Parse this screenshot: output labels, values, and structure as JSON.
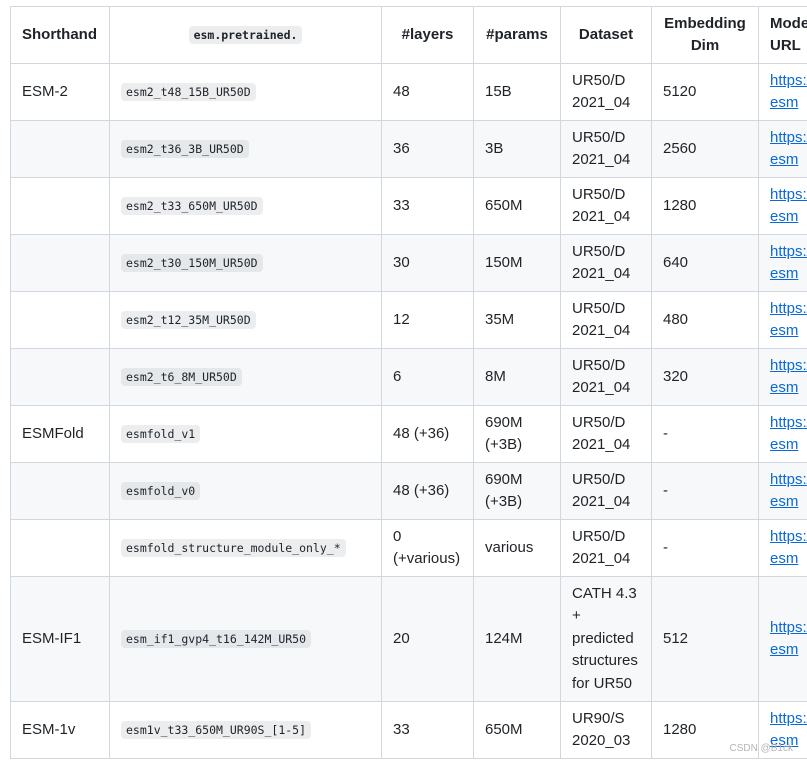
{
  "table": {
    "headers": [
      "Shorthand",
      "esm.pretrained.",
      "#layers",
      "#params",
      "Dataset",
      "Embedding\nDim",
      "Model URL"
    ],
    "rows": [
      {
        "shorthand": "ESM-2",
        "name": "esm2_t48_15B_UR50D",
        "layers": "48",
        "params": "15B",
        "dataset": "UR50/D\n2021_04",
        "dim": "5120",
        "url": "https://\nesm"
      },
      {
        "shorthand": "",
        "name": "esm2_t36_3B_UR50D",
        "layers": "36",
        "params": "3B",
        "dataset": "UR50/D\n2021_04",
        "dim": "2560",
        "url": "https://\nesm"
      },
      {
        "shorthand": "",
        "name": "esm2_t33_650M_UR50D",
        "layers": "33",
        "params": "650M",
        "dataset": "UR50/D\n2021_04",
        "dim": "1280",
        "url": "https://\nesm"
      },
      {
        "shorthand": "",
        "name": "esm2_t30_150M_UR50D",
        "layers": "30",
        "params": "150M",
        "dataset": "UR50/D\n2021_04",
        "dim": "640",
        "url": "https://\nesm"
      },
      {
        "shorthand": "",
        "name": "esm2_t12_35M_UR50D",
        "layers": "12",
        "params": "35M",
        "dataset": "UR50/D\n2021_04",
        "dim": "480",
        "url": "https://\nesm"
      },
      {
        "shorthand": "",
        "name": "esm2_t6_8M_UR50D",
        "layers": "6",
        "params": "8M",
        "dataset": "UR50/D\n2021_04",
        "dim": "320",
        "url": "https://\nesm"
      },
      {
        "shorthand": "ESMFold",
        "name": "esmfold_v1",
        "layers": "48 (+36)",
        "params": "690M\n(+3B)",
        "dataset": "UR50/D\n2021_04",
        "dim": "-",
        "url": "https://\nesm"
      },
      {
        "shorthand": "",
        "name": "esmfold_v0",
        "layers": "48 (+36)",
        "params": "690M\n(+3B)",
        "dataset": "UR50/D\n2021_04",
        "dim": "-",
        "url": "https://\nesm"
      },
      {
        "shorthand": "",
        "name": "esmfold_structure_module_only_*",
        "layers": "0\n(+various)",
        "params": "various",
        "dataset": "UR50/D\n2021_04",
        "dim": "-",
        "url": "https://\nesm"
      },
      {
        "shorthand": "ESM-IF1",
        "name": "esm_if1_gvp4_t16_142M_UR50",
        "layers": "20",
        "params": "124M",
        "dataset": "CATH 4.3\n+\npredicted\nstructures\nfor UR50",
        "dim": "512",
        "url": "https://\nesm"
      },
      {
        "shorthand": "ESM-1v",
        "name": "esm1v_t33_650M_UR90S_[1-5]",
        "layers": "33",
        "params": "650M",
        "dataset": "UR90/S\n2020_03",
        "dim": "1280",
        "url": "https://\nesm"
      }
    ]
  },
  "watermark": "CSDN @B1ck"
}
